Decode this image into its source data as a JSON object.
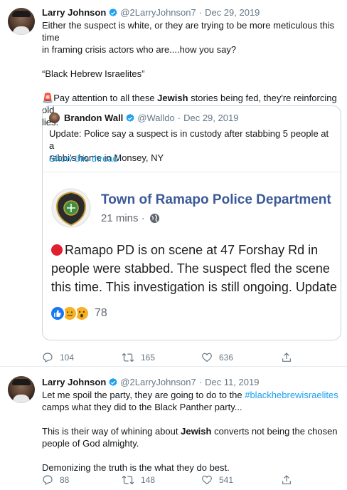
{
  "tweet1": {
    "author_name": "Larry Johnson",
    "handle": "@2LarryJohnson7",
    "separator": "·",
    "date": "Dec 29, 2019",
    "line1": "Either the suspect is white, or they are trying to be more meticulous this time",
    "line2": "in framing crisis actors who are....how you say?",
    "line3": "“Black Hebrew Israelites”",
    "line4_emoji": "🚨",
    "line4_pre": "Pay attention to all these ",
    "line4_bold": "Jewish",
    "line4_post": " stories being fed, they're reinforcing old",
    "line5": "lies.",
    "quote": {
      "author_name": "Brandon Wall",
      "handle": "@Walldo",
      "date": "Dec 29, 2019",
      "line1": "Update: Police say a suspect is in custody after stabbing 5 people at a",
      "line2": "rabbi's home in Monsey, NY",
      "show_thread": "Show this thread",
      "card": {
        "page_name": "Town of Ramapo Police Department",
        "time": "21 mins ·",
        "line1": "Ramapo PD is on scene at 47 Forshay Rd in",
        "line2": "people were stabbed. The suspect fled the scene",
        "line3": "this time. This investigation is still ongoing. Update",
        "reaction_count": "78"
      }
    },
    "replies": "104",
    "retweets": "165",
    "likes": "636"
  },
  "tweet2": {
    "author_name": "Larry Johnson",
    "handle": "@2LarryJohnson7",
    "date": "Dec 11, 2019",
    "line1": "Let me spoil the party, they are going to do to the ",
    "line1_hashtag": "#blackhebrewisraelites",
    "line2": " camps what they did to the Black Panther party...",
    "line3_pre": "This is their way of whining about ",
    "line3_bold": "Jewish",
    "line3_post": " converts not being the chosen",
    "line4": "people of God almighty.",
    "line5": "Demonizing the truth is the what they do best.",
    "replies": "88",
    "retweets": "148",
    "likes": "541"
  },
  "colors": {
    "link": "#1da1f2",
    "secondary_text": "#657786",
    "facebook_blue": "#3b5998"
  }
}
